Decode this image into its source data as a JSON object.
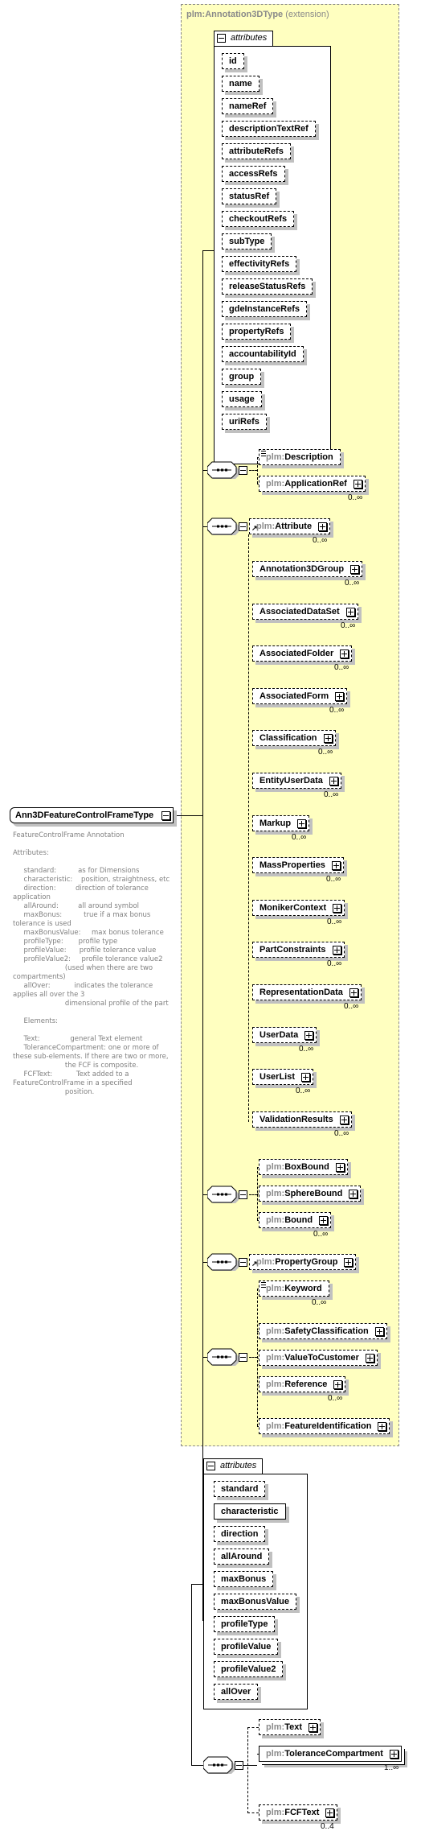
{
  "root": {
    "name": "Ann3DFeatureControlFrameType",
    "documentation": [
      "FeatureControlFrame Annotation",
      "",
      "Attributes:",
      "",
      "     standard:          as for Dimensions",
      "     characteristic:    position, straightness, etc",
      "     direction:         direction of tolerance application",
      "     allAround:         all around symbol",
      "     maxBonus:          true if a max bonus tolerance is used",
      "     maxBonusValue:     max bonus tolerance",
      "     profileType:       profile type",
      "     profileValue:      profile tolerance value",
      "     profileValue2:     profile tolerance value2",
      "                        (used when there are two compartments)",
      "     allOver:           indicates the tolerance applies all over the 3",
      "                        dimensional profile of the part",
      "",
      "     Elements:",
      "",
      "     Text:              general Text element",
      "     ToleranceCompartment: one or more of these sub-elements. If there are two or more,",
      "                        the FCF is composite.",
      "     FCFText:           Text added to a FeatureControlFrame in a specified",
      "                        position."
    ]
  },
  "extension": {
    "base": "plm:Annotation3DType",
    "suffix": "(extension)",
    "attributes_label": "attributes",
    "attributes": [
      "id",
      "name",
      "nameRef",
      "descriptionTextRef",
      "attributeRefs",
      "accessRefs",
      "statusRef",
      "checkoutRefs",
      "subType",
      "effectivityRefs",
      "releaseStatusRefs",
      "gdeInstanceRefs",
      "propertyRefs",
      "accountabilityId",
      "group",
      "usage",
      "uriRefs"
    ],
    "seq1": [
      {
        "prefix": "plm:",
        "name": "Description",
        "card": "",
        "expand": false,
        "doc": true
      },
      {
        "prefix": "plm:",
        "name": "ApplicationRef",
        "card": "0..∞",
        "expand": true
      }
    ],
    "seq2_head": {
      "prefix": "plm:",
      "name": "Attribute",
      "card": "0..∞"
    },
    "seq2_subs": [
      {
        "name": "Annotation3DGroup",
        "card": "0..∞"
      },
      {
        "name": "AssociatedDataSet",
        "card": "0..∞"
      },
      {
        "name": "AssociatedFolder",
        "card": "0..∞"
      },
      {
        "name": "AssociatedForm",
        "card": "0..∞"
      },
      {
        "name": "Classification",
        "card": "0..∞"
      },
      {
        "name": "EntityUserData",
        "card": "0..∞"
      },
      {
        "name": "Markup",
        "card": "0..∞"
      },
      {
        "name": "MassProperties",
        "card": "0..∞"
      },
      {
        "name": "MonikerContext",
        "card": "0..∞"
      },
      {
        "name": "PartConstraints",
        "card": "0..∞"
      },
      {
        "name": "RepresentationData",
        "card": "0..∞"
      },
      {
        "name": "UserData",
        "card": "0..∞"
      },
      {
        "name": "UserList",
        "card": "0..∞"
      },
      {
        "name": "ValidationResults",
        "card": "0..∞"
      }
    ],
    "seq3": [
      {
        "prefix": "plm:",
        "name": "BoxBound",
        "card": ""
      },
      {
        "prefix": "plm:",
        "name": "SphereBound",
        "card": ""
      },
      {
        "prefix": "plm:",
        "name": "Bound",
        "card": "0..∞"
      }
    ],
    "seq4": {
      "prefix": "plm:",
      "name": "PropertyGroup",
      "card": ""
    },
    "seq5": [
      {
        "prefix": "plm:",
        "name": "Keyword",
        "card": "0..∞"
      },
      {
        "prefix": "plm:",
        "name": "SafetyClassification",
        "card": ""
      },
      {
        "prefix": "plm:",
        "name": "ValueToCustomer",
        "card": ""
      },
      {
        "prefix": "plm:",
        "name": "Reference",
        "card": "0..∞"
      },
      {
        "prefix": "plm:",
        "name": "FeatureIdentification",
        "card": ""
      }
    ]
  },
  "own": {
    "attributes_label": "attributes",
    "attributes": [
      {
        "name": "standard",
        "required": false
      },
      {
        "name": "characteristic",
        "required": true
      },
      {
        "name": "direction",
        "required": false
      },
      {
        "name": "allAround",
        "required": false
      },
      {
        "name": "maxBonus",
        "required": false
      },
      {
        "name": "maxBonusValue",
        "required": false
      },
      {
        "name": "profileType",
        "required": false
      },
      {
        "name": "profileValue",
        "required": false
      },
      {
        "name": "profileValue2",
        "required": false
      },
      {
        "name": "allOver",
        "required": false
      }
    ],
    "seq": [
      {
        "prefix": "plm:",
        "name": "Text",
        "card": "",
        "required": false
      },
      {
        "prefix": "plm:",
        "name": "ToleranceCompartment",
        "card": "1..∞",
        "required": true
      },
      {
        "prefix": "plm:",
        "name": "FCFText",
        "card": "0..4",
        "required": false
      }
    ]
  }
}
